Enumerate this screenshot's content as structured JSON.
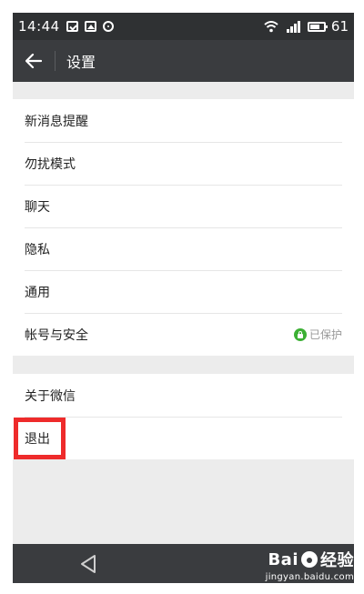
{
  "status_bar": {
    "time": "14:44",
    "icons": [
      "mail-notification-icon",
      "image-notification-icon",
      "sync-notification-icon"
    ],
    "battery_level": "61"
  },
  "header": {
    "title": "设置"
  },
  "settings": {
    "group1": [
      {
        "label": "新消息提醒"
      },
      {
        "label": "勿扰模式"
      },
      {
        "label": "聊天"
      },
      {
        "label": "隐私"
      },
      {
        "label": "通用"
      },
      {
        "label": "帐号与安全",
        "status": "已保护"
      }
    ],
    "group2": [
      {
        "label": "关于微信"
      },
      {
        "label": "退出"
      }
    ]
  },
  "watermark": {
    "brand_pre": "Bai",
    "brand_post": "经验",
    "url": "jingyan.baidu.com"
  },
  "colors": {
    "header_bg": "#3a3c3f",
    "status_bg": "#2f3133",
    "highlight": "#ee2b2b",
    "secure_green": "#3cb034"
  }
}
